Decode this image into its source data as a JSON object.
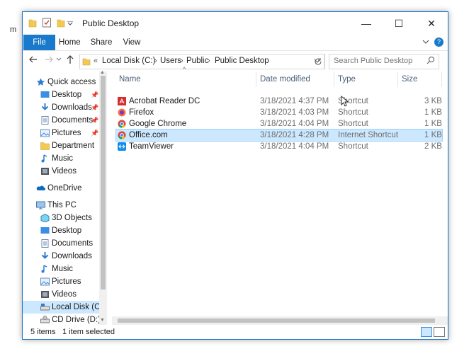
{
  "window": {
    "title": "Public Desktop",
    "minimize_glyph": "—",
    "maximize_glyph": "☐",
    "close_glyph": "✕"
  },
  "ribbon": {
    "tabs": [
      "File",
      "Home",
      "Share",
      "View"
    ],
    "help_glyph": "?"
  },
  "address": {
    "overflow": "«",
    "crumbs": [
      "Local Disk (C:)",
      "Users",
      "Public",
      "Public Desktop"
    ],
    "search_placeholder": "Search Public Desktop"
  },
  "nav": {
    "items": [
      {
        "label": "Quick access",
        "icon": "star-icon"
      },
      {
        "label": "Desktop",
        "icon": "desktop-folder-icon",
        "pinned": true
      },
      {
        "label": "Downloads",
        "icon": "download-icon",
        "pinned": true
      },
      {
        "label": "Documents",
        "icon": "documents-icon",
        "pinned": true
      },
      {
        "label": "Pictures",
        "icon": "pictures-icon",
        "pinned": true
      },
      {
        "label": "Department",
        "icon": "folder-icon"
      },
      {
        "label": "Music",
        "icon": "music-icon"
      },
      {
        "label": "Videos",
        "icon": "videos-icon"
      },
      {
        "label": "OneDrive",
        "icon": "onedrive-icon"
      },
      {
        "label": "This PC",
        "icon": "pc-icon"
      },
      {
        "label": "3D Objects",
        "icon": "3d-objects-icon"
      },
      {
        "label": "Desktop",
        "icon": "desktop-folder-icon"
      },
      {
        "label": "Documents",
        "icon": "documents-icon"
      },
      {
        "label": "Downloads",
        "icon": "download-icon"
      },
      {
        "label": "Music",
        "icon": "music-icon"
      },
      {
        "label": "Pictures",
        "icon": "pictures-icon"
      },
      {
        "label": "Videos",
        "icon": "videos-icon"
      },
      {
        "label": "Local Disk (C:)",
        "icon": "drive-icon",
        "selected": true
      },
      {
        "label": "CD Drive (D:) CP",
        "icon": "cd-drive-icon"
      }
    ]
  },
  "columns": [
    "Name",
    "Date modified",
    "Type",
    "Size"
  ],
  "files": [
    {
      "name": "Acrobat Reader DC",
      "date": "3/18/2021 4:37 PM",
      "type": "Shortcut",
      "size": "3 KB",
      "icon": "acrobat-icon"
    },
    {
      "name": "Firefox",
      "date": "3/18/2021 4:03 PM",
      "type": "Shortcut",
      "size": "1 KB",
      "icon": "firefox-icon"
    },
    {
      "name": "Google Chrome",
      "date": "3/18/2021 4:04 PM",
      "type": "Shortcut",
      "size": "1 KB",
      "icon": "chrome-icon"
    },
    {
      "name": "Office.com",
      "date": "3/18/2021 4:28 PM",
      "type": "Internet Shortcut",
      "size": "1 KB",
      "icon": "chrome-icon",
      "selected": true
    },
    {
      "name": "TeamViewer",
      "date": "3/18/2021 4:04 PM",
      "type": "Shortcut",
      "size": "2 KB",
      "icon": "teamviewer-icon"
    }
  ],
  "status": {
    "count": "5 items",
    "selection": "1 item selected"
  },
  "colors": {
    "accent": "#1979ca",
    "selection": "#cce8ff",
    "folder": "#f4c951"
  }
}
